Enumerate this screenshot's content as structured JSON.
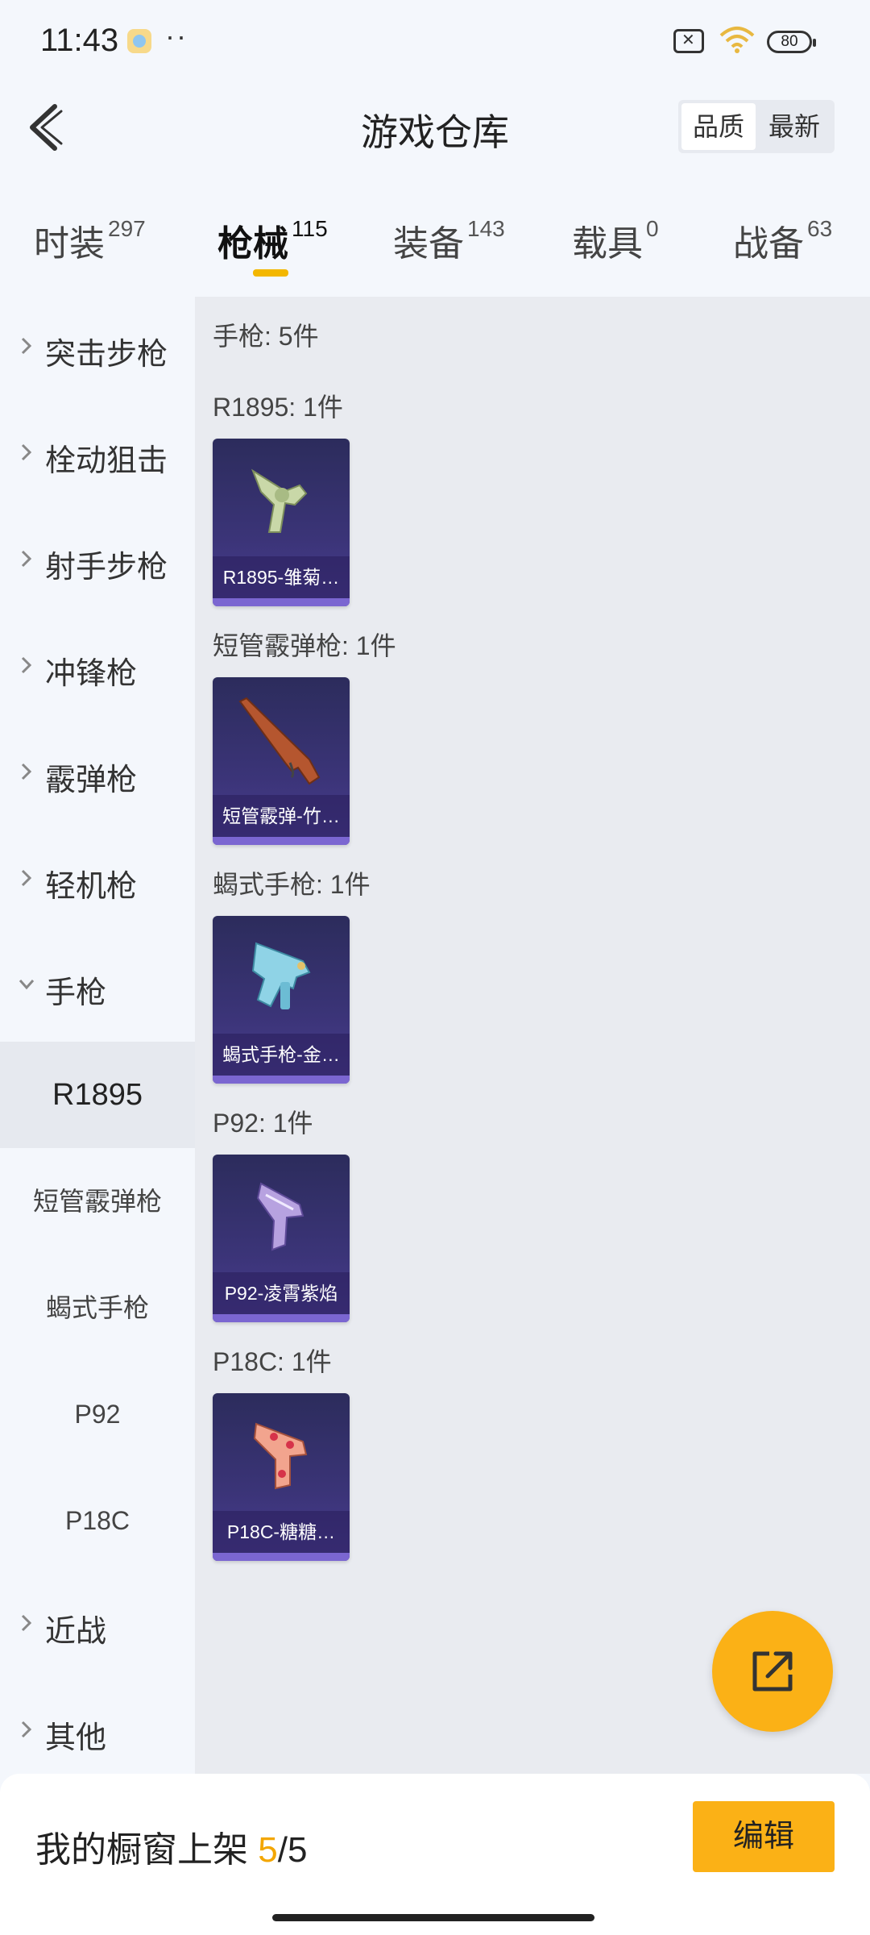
{
  "status_bar": {
    "time": "11:43",
    "dots": "··",
    "battery": "80"
  },
  "header": {
    "title": "游戏仓库",
    "sort_quality": "品质",
    "sort_latest": "最新"
  },
  "tabs": [
    {
      "label": "时装",
      "count": "297"
    },
    {
      "label": "枪械",
      "count": "115"
    },
    {
      "label": "装备",
      "count": "143"
    },
    {
      "label": "载具",
      "count": "0"
    },
    {
      "label": "战备",
      "count": "63"
    }
  ],
  "sidebar": {
    "categories": [
      "突击步枪",
      "栓动狙击",
      "射手步枪",
      "冲锋枪",
      "霰弹枪",
      "轻机枪",
      "手枪"
    ],
    "subitems": [
      "R1895",
      "短管霰弹枪",
      "蝎式手枪",
      "P92",
      "P18C"
    ],
    "bottom_categories": [
      "近战",
      "其他"
    ]
  },
  "content": {
    "summary": "手枪: 5件",
    "groups": [
      {
        "title": "R1895: 1件",
        "card_name": "R1895-雏菊…"
      },
      {
        "title": "短管霰弹枪: 1件",
        "card_name": "短管霰弹-竹…"
      },
      {
        "title": "蝎式手枪: 1件",
        "card_name": "蝎式手枪-金…"
      },
      {
        "title": "P92: 1件",
        "card_name": "P92-凌霄紫焰"
      },
      {
        "title": "P18C: 1件",
        "card_name": "P18C-糖糖…"
      }
    ]
  },
  "bottom_bar": {
    "label": "我的橱窗上架",
    "count": "5",
    "total": "/5",
    "edit": "编辑"
  },
  "colors": {
    "accent": "#fbb116",
    "underline": "#f3b700",
    "card_bg": "#3b3478"
  }
}
